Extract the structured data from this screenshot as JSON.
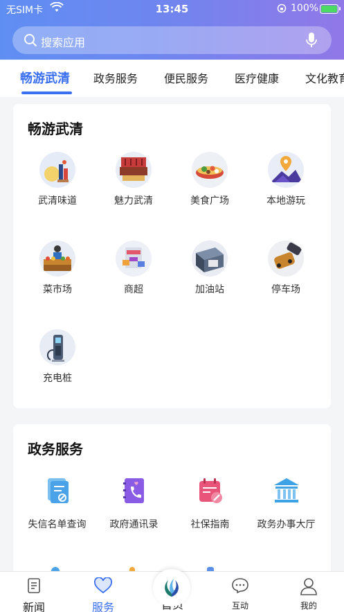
{
  "status": {
    "carrier": "无SIM卡",
    "time": "13:45",
    "battery": "100%"
  },
  "search": {
    "placeholder": "搜索应用"
  },
  "tabs": [
    {
      "label": "畅游武清",
      "active": true
    },
    {
      "label": "政务服务"
    },
    {
      "label": "便民服务"
    },
    {
      "label": "医疗健康"
    },
    {
      "label": "文化教育"
    }
  ],
  "section1": {
    "title": "畅游武清",
    "items": [
      {
        "label": "武清味道",
        "icon": "food-fruit-icon"
      },
      {
        "label": "魅力武清",
        "icon": "theater-icon"
      },
      {
        "label": "美食广场",
        "icon": "food-bowl-icon"
      },
      {
        "label": "本地游玩",
        "icon": "location-pin-icon"
      },
      {
        "label": "菜市场",
        "icon": "market-stall-icon"
      },
      {
        "label": "商超",
        "icon": "supermarket-icon"
      },
      {
        "label": "加油站",
        "icon": "gas-station-icon"
      },
      {
        "label": "停车场",
        "icon": "parking-car-icon"
      },
      {
        "label": "充电桩",
        "icon": "charging-pile-icon"
      }
    ]
  },
  "section2": {
    "title": "政务服务",
    "items": [
      {
        "label": "失信名单查询",
        "icon": "blacklist-query-icon",
        "color": "#4aa3e8"
      },
      {
        "label": "政府通讯录",
        "icon": "phone-book-icon",
        "color": "#8a5ce6"
      },
      {
        "label": "社保指南",
        "icon": "calendar-edit-icon",
        "color": "#e9557a"
      },
      {
        "label": "政务办事大厅",
        "icon": "government-building-icon",
        "color": "#3ea2e6"
      }
    ]
  },
  "bottom_nav": [
    {
      "label": "新闻",
      "icon": "news-icon"
    },
    {
      "label": "服务",
      "icon": "heart-icon",
      "active": true
    },
    {
      "label": "首页",
      "icon": "home-logo-icon"
    },
    {
      "label": "互动",
      "icon": "chat-bubble-icon"
    },
    {
      "label": "我的",
      "icon": "user-icon"
    }
  ],
  "colors": {
    "accent": "#3a6ff2",
    "header_start": "#5f8ef3",
    "header_end": "#9178e8"
  }
}
